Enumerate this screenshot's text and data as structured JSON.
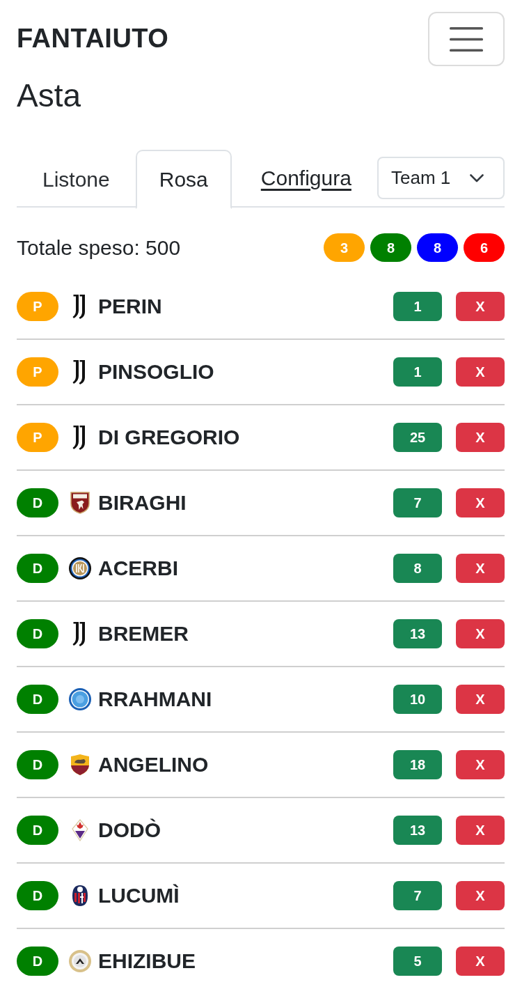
{
  "navbar": {
    "brand": "FANTAIUTO"
  },
  "page_title": "Asta",
  "tabs": [
    {
      "kind": "tab",
      "label": "Listone",
      "selected": false
    },
    {
      "kind": "tab",
      "label": "Rosa",
      "selected": true
    },
    {
      "kind": "link",
      "label": "Configura",
      "selected": false
    }
  ],
  "team_select": {
    "value": "Team 1"
  },
  "summary": {
    "total": "Totale speso: 500",
    "role_counts": [
      {
        "count": "3",
        "color": "#ffa500"
      },
      {
        "count": "8",
        "color": "#008000"
      },
      {
        "count": "8",
        "color": "#0000ff"
      },
      {
        "count": "6",
        "color": "#ff0000"
      }
    ]
  },
  "players": [
    {
      "role": "P",
      "color": "#ffa500",
      "crest": {
        "kind": "monogram"
      },
      "name": "PERIN",
      "price": "1",
      "remove": "X"
    },
    {
      "role": "P",
      "color": "#ffa500",
      "crest": {
        "kind": "monogram"
      },
      "name": "PINSOGLIO",
      "price": "1",
      "remove": "X"
    },
    {
      "role": "P",
      "color": "#ffa500",
      "crest": {
        "kind": "monogram"
      },
      "name": "DI GREGORIO",
      "price": "25",
      "remove": "X"
    },
    {
      "role": "D",
      "color": "#008000",
      "crest": {
        "kind": "bull"
      },
      "name": "BIRAGHI",
      "price": "7",
      "remove": "X"
    },
    {
      "role": "D",
      "color": "#008000",
      "crest": {
        "kind": "ringed"
      },
      "name": "ACERBI",
      "price": "8",
      "remove": "X"
    },
    {
      "role": "D",
      "color": "#008000",
      "crest": {
        "kind": "monogram"
      },
      "name": "BREMER",
      "price": "13",
      "remove": "X"
    },
    {
      "role": "D",
      "color": "#008000",
      "crest": {
        "kind": "round"
      },
      "name": "RRAHMANI",
      "price": "10",
      "remove": "X"
    },
    {
      "role": "D",
      "color": "#008000",
      "crest": {
        "kind": "wolf"
      },
      "name": "ANGELINO",
      "price": "18",
      "remove": "X"
    },
    {
      "role": "D",
      "color": "#008000",
      "crest": {
        "kind": "lily"
      },
      "name": "DODÒ",
      "price": "13",
      "remove": "X"
    },
    {
      "role": "D",
      "color": "#008000",
      "crest": {
        "kind": "striped"
      },
      "name": "LUCUMÌ",
      "price": "7",
      "remove": "X"
    },
    {
      "role": "D",
      "color": "#008000",
      "crest": {
        "kind": "wreath"
      },
      "name": "EHIZIBUE",
      "price": "5",
      "remove": "X"
    }
  ]
}
